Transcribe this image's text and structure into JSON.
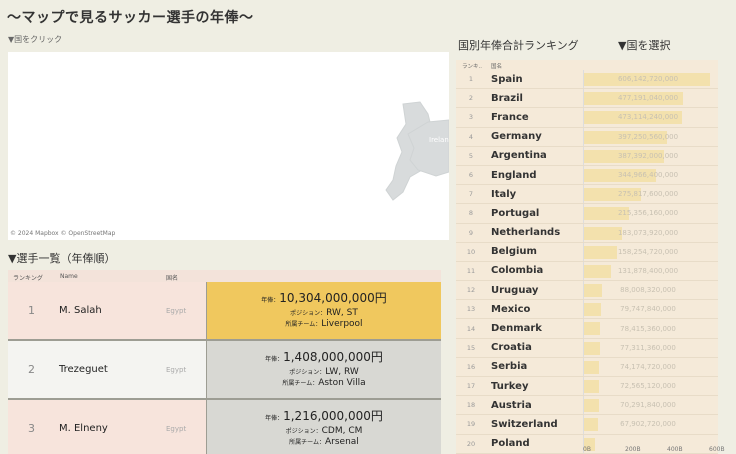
{
  "page_title": "〜マップで見るサッカー選手の年俸〜",
  "map": {
    "hint": "▼国をクリック",
    "attribution": "© 2024 Mapbox © OpenStreetMap",
    "label": "Irelan"
  },
  "players": {
    "title": "▼選手一覧（年俸順）",
    "headers": {
      "rank": "ランキング",
      "name": "Name",
      "country": "国名"
    },
    "labels": {
      "salary": "年俸：",
      "position": "ポジション：",
      "team": "所属チーム："
    },
    "rows": [
      {
        "rank": "1",
        "name": "M. Salah",
        "country": "Egypt",
        "salary": "10,304,000,000円",
        "position": "RW, ST",
        "team": "Liverpool",
        "highlight": true
      },
      {
        "rank": "2",
        "name": "Trezeguet",
        "country": "Egypt",
        "salary": "1,408,000,000円",
        "position": "LW, RW",
        "team": "Aston Villa",
        "highlight": false
      },
      {
        "rank": "3",
        "name": "M. Elneny",
        "country": "Egypt",
        "salary": "1,216,000,000円",
        "position": "CDM, CM",
        "team": "Arsenal",
        "highlight": false
      }
    ]
  },
  "ranking": {
    "title": "国別年俸合計ランキング",
    "select_title": "▼国を選択",
    "headers": {
      "rank": "ランキ..",
      "country": "国名"
    },
    "axis_ticks": [
      "0B",
      "200B",
      "400B",
      "600B"
    ],
    "max": 650142720000
  },
  "chart_data": {
    "type": "bar",
    "categories": [
      "Spain",
      "Brazil",
      "France",
      "Germany",
      "Argentina",
      "England",
      "Italy",
      "Portugal",
      "Netherlands",
      "Belgium",
      "Colombia",
      "Uruguay",
      "Mexico",
      "Denmark",
      "Croatia",
      "Serbia",
      "Turkey",
      "Austria",
      "Switzerland",
      "Poland"
    ],
    "values": [
      606142720000,
      477191040000,
      473114240000,
      397250560000,
      387392000000,
      344966400000,
      275817600000,
      215356160000,
      183073920000,
      158254720000,
      131878400000,
      88008320000,
      79747840000,
      78415360000,
      77311360000,
      74174720000,
      72565120000,
      70291840000,
      67902720000,
      54000000000
    ],
    "value_labels": [
      "606,142,720,000",
      "477,191,040,000",
      "473,114,240,000",
      "397,250,560,000",
      "387,392,000,000",
      "344,966,400,000",
      "275,817,600,000",
      "215,356,160,000",
      "183,073,920,000",
      "158,254,720,000",
      "131,878,400,000",
      "88,008,320,000",
      "79,747,840,000",
      "78,415,360,000",
      "77,311,360,000",
      "74,174,720,000",
      "72,565,120,000",
      "70,291,840,000",
      "67,902,720,000",
      ""
    ],
    "xlim": [
      0,
      650000000000
    ]
  },
  "colors": {
    "highlight": "#f0c85e",
    "info_bg": "#d8d8d3",
    "row_pink": "#f7e4dc",
    "bar": "#f3e1ad"
  }
}
